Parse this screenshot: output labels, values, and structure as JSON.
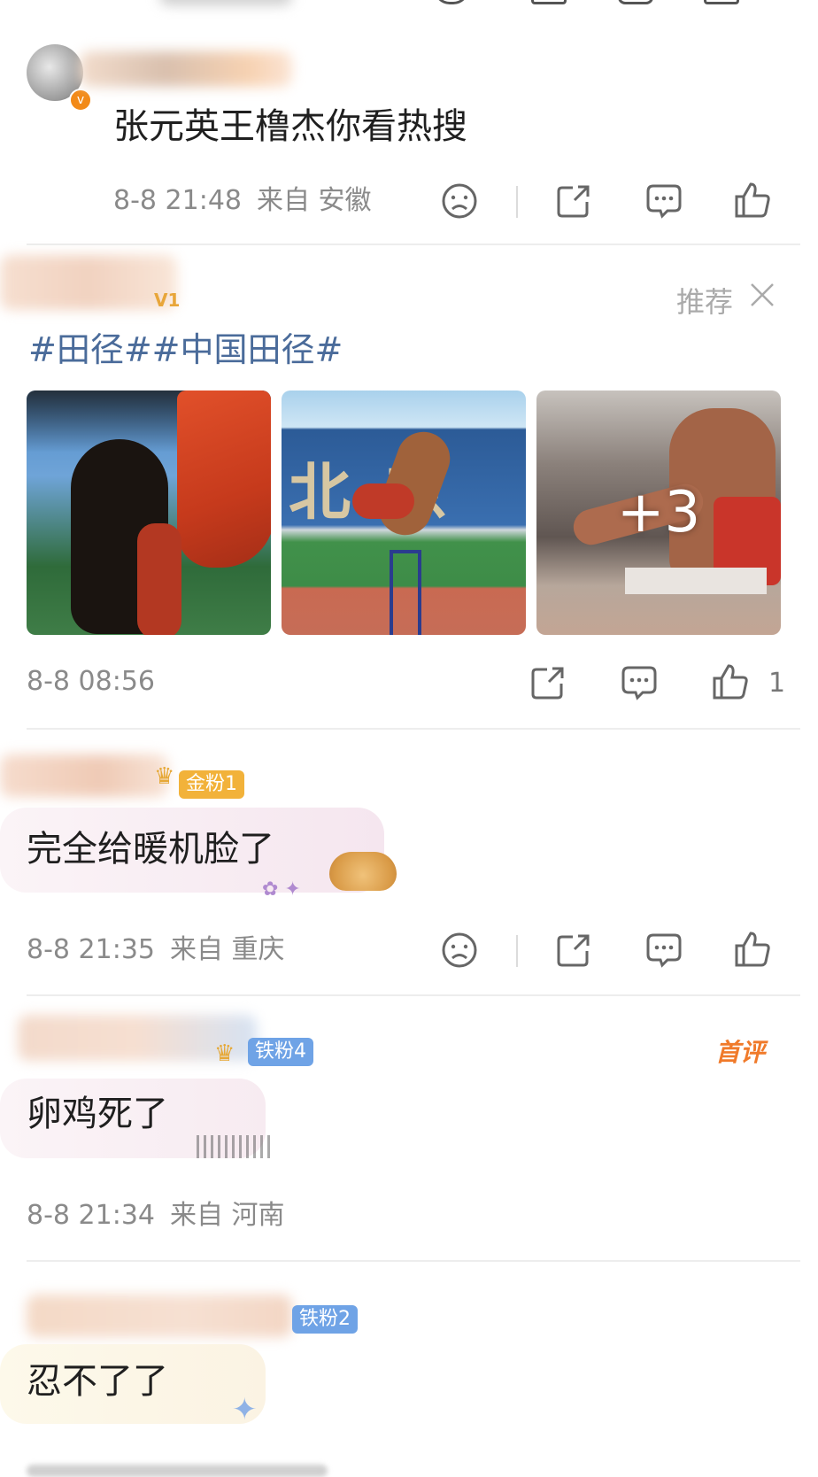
{
  "post1": {
    "comment_text": "张元英王橹杰你看热搜",
    "time": "8-8 21:48",
    "location": "来自 安徽"
  },
  "post2": {
    "recommend_label": "推荐",
    "hashtags": "#田径##中国田径#",
    "more_photos": "+3",
    "time": "8-8 08:56",
    "like_count": "1"
  },
  "post3": {
    "badge": "金粉1",
    "comment_text": "完全给暖机脸了",
    "time": "8-8 21:35",
    "location": "来自 重庆"
  },
  "post4": {
    "badge": "铁粉4",
    "first_comment_label": "首评",
    "comment_text": "卵鸡死了",
    "time": "8-8 21:34",
    "location": "来自 河南"
  },
  "post5": {
    "badge": "铁粉2",
    "comment_text": "忍不了了"
  },
  "colors": {
    "hashtag": "#4a6b9a",
    "gold_badge": "#f2b23a",
    "iron_badge": "#6fa3e6",
    "first_comment": "#f07a2a"
  }
}
